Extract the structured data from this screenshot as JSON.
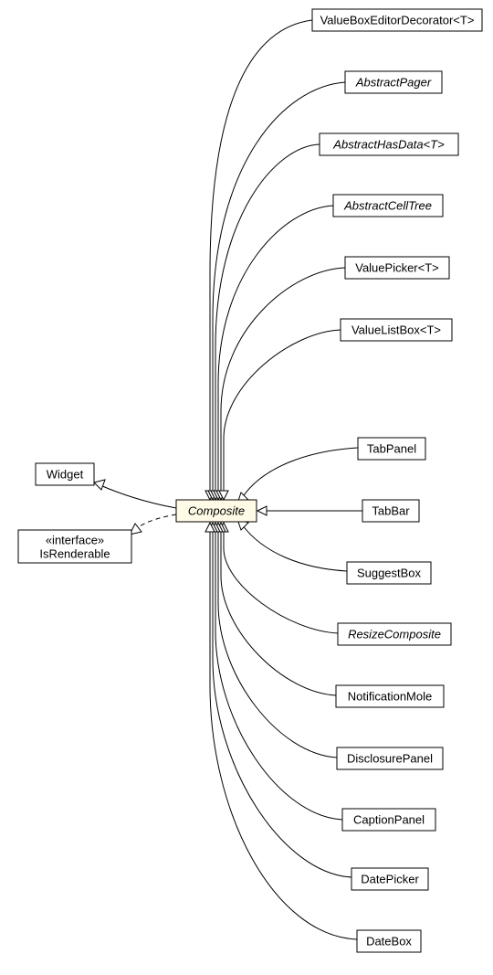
{
  "chart_data": {
    "type": "uml-class-diagram",
    "center_node": {
      "id": "composite",
      "label": "Composite",
      "style": "abstract"
    },
    "parent_nodes": [
      {
        "id": "widget",
        "label": "Widget",
        "relation": "extends"
      },
      {
        "id": "isrenderable",
        "label_lines": [
          "«interface»",
          "IsRenderable"
        ],
        "relation": "implements"
      }
    ],
    "child_nodes": [
      {
        "id": "valueboxeditor",
        "label": "ValueBoxEditorDecorator<T>"
      },
      {
        "id": "abstractpager",
        "label": "AbstractPager",
        "style": "abstract"
      },
      {
        "id": "abstracthasdata",
        "label": "AbstractHasData<T>",
        "style": "abstract"
      },
      {
        "id": "abstractcelltree",
        "label": "AbstractCellTree",
        "style": "abstract"
      },
      {
        "id": "valuepicker",
        "label": "ValuePicker<T>"
      },
      {
        "id": "valuelistbox",
        "label": "ValueListBox<T>"
      },
      {
        "id": "tabpanel",
        "label": "TabPanel"
      },
      {
        "id": "tabbar",
        "label": "TabBar"
      },
      {
        "id": "suggestbox",
        "label": "SuggestBox"
      },
      {
        "id": "resizecomposite",
        "label": "ResizeComposite",
        "style": "abstract"
      },
      {
        "id": "notificationmole",
        "label": "NotificationMole"
      },
      {
        "id": "disclosurepanel",
        "label": "DisclosurePanel"
      },
      {
        "id": "captionpanel",
        "label": "CaptionPanel"
      },
      {
        "id": "datepicker",
        "label": "DatePicker"
      },
      {
        "id": "datebox",
        "label": "DateBox"
      }
    ]
  },
  "nodes": {
    "composite": "Composite",
    "widget": "Widget",
    "isrenderable_l1": "«interface»",
    "isrenderable_l2": "IsRenderable",
    "valueboxeditor": "ValueBoxEditorDecorator<T>",
    "abstractpager": "AbstractPager",
    "abstracthasdata": "AbstractHasData<T>",
    "abstractcelltree": "AbstractCellTree",
    "valuepicker": "ValuePicker<T>",
    "valuelistbox": "ValueListBox<T>",
    "tabpanel": "TabPanel",
    "tabbar": "TabBar",
    "suggestbox": "SuggestBox",
    "resizecomposite": "ResizeComposite",
    "notificationmole": "NotificationMole",
    "disclosurepanel": "DisclosurePanel",
    "captionpanel": "CaptionPanel",
    "datepicker": "DatePicker",
    "datebox": "DateBox"
  }
}
